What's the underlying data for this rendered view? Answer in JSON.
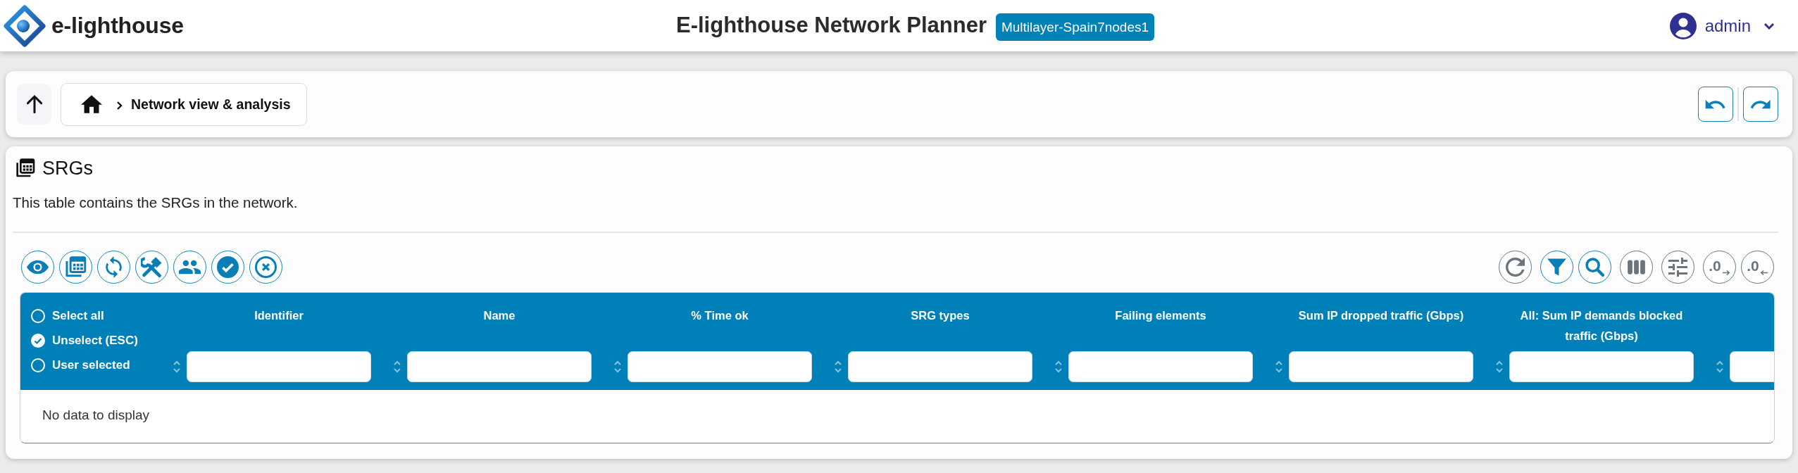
{
  "header": {
    "logo_text": "e-lighthouse",
    "title": "E-lighthouse Network Planner",
    "project": "Multilayer-Spain7nodes1",
    "user": "admin"
  },
  "breadcrumb": {
    "current": "Network view & analysis"
  },
  "panel": {
    "title": "SRGs",
    "description": "This table contains the SRGs in the network."
  },
  "table_tools": [
    {
      "active": false
    },
    {
      "active": true
    },
    {
      "active": true
    },
    {
      "active": false
    },
    {
      "active": false
    },
    {
      "label": ".0",
      "active": false
    },
    {
      "label": ".0",
      "active": false
    }
  ],
  "table": {
    "select_options": [
      {
        "label": "Select all",
        "selected": false
      },
      {
        "label": "Unselect (ESC)",
        "selected": true
      },
      {
        "label": "User selected",
        "selected": false
      }
    ],
    "columns": [
      {
        "label": "Identifier",
        "sortable": true
      },
      {
        "label": "Name",
        "sortable": true
      },
      {
        "label": "% Time ok",
        "sortable": true
      },
      {
        "label": "SRG types",
        "sortable": true
      },
      {
        "label": "Failing elements",
        "sortable": true
      },
      {
        "label": "Sum IP dropped traffic (Gbps)",
        "sortable": true
      },
      {
        "label": "All: Sum IP demands blocked traffic (Gbps)",
        "sortable": true
      },
      {
        "sortable": true
      }
    ],
    "empty_message": "No data to display"
  }
}
